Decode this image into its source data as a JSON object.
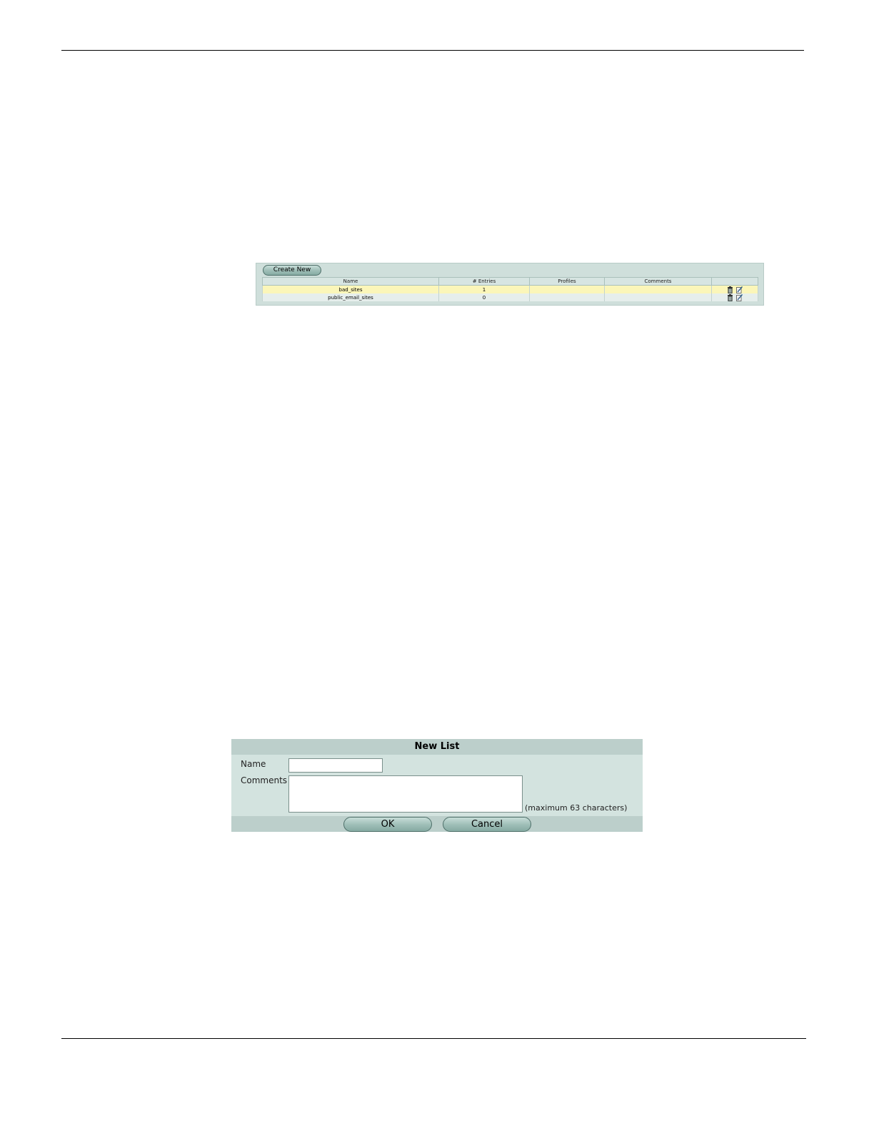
{
  "list_view": {
    "create_new_label": "Create New",
    "columns": [
      "Name",
      "# Entries",
      "Profiles",
      "Comments",
      ""
    ],
    "rows": [
      {
        "name": "bad_sites",
        "entries": "1",
        "profiles": "",
        "comments": ""
      },
      {
        "name": "public_email_sites",
        "entries": "0",
        "profiles": "",
        "comments": ""
      }
    ],
    "icons": {
      "delete": "trash-icon",
      "edit": "edit-icon"
    },
    "colors": {
      "highlight_row": "#fbf6b9",
      "panel": "#cfdfdb"
    }
  },
  "dialog": {
    "title": "New List",
    "name_label": "Name",
    "name_value": "",
    "comments_label": "Comments",
    "comments_value": "",
    "max_hint": "(maximum 63 characters)",
    "ok_label": "OK",
    "cancel_label": "Cancel"
  }
}
